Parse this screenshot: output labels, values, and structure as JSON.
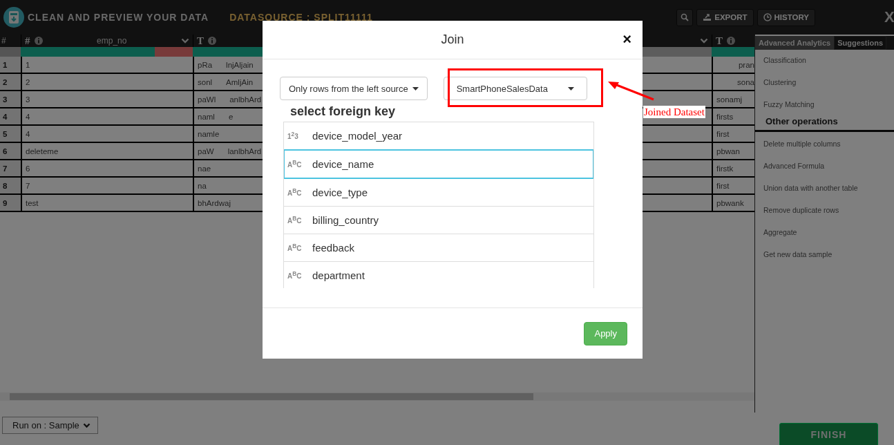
{
  "header": {
    "title": "CLEAN AND PREVIEW YOUR DATA",
    "datasource": "DATASOURCE : SPLIT11111",
    "buttons": [
      {
        "kind": "search"
      },
      {
        "kind": "export",
        "label": "EXPORT"
      },
      {
        "kind": "history",
        "label": "HISTORY"
      }
    ],
    "close": "X"
  },
  "table": {
    "index_heading": "#",
    "columns": [
      {
        "type": "#",
        "name": "emp_no",
        "level": 0.78,
        "menu": true
      },
      {
        "type": "T",
        "level": 0.5,
        "menu": true
      },
      {
        "type": "T",
        "menu": false
      }
    ],
    "rows": [
      {
        "index": "1",
        "cells": [
          [
            "1"
          ],
          [
            "pRa",
            "lnjAljain"
          ],
          [
            "pran"
          ]
        ],
        "right_aligned": true
      },
      {
        "index": "2",
        "cells": [
          [
            "2"
          ],
          [
            "sonl",
            "AmljAin"
          ],
          [
            "sona"
          ]
        ],
        "right_aligned": true
      },
      {
        "index": "3",
        "cells": [
          [
            "3"
          ],
          [
            "paWl",
            "anlbhArd"
          ],
          [
            "sonamj"
          ]
        ],
        "right_aligned": false
      },
      {
        "index": "4",
        "cells": [
          [
            "4"
          ],
          [
            "naml",
            "e"
          ],
          [
            "firsts"
          ]
        ],
        "right_aligned": false
      },
      {
        "index": "5",
        "cells": [
          [
            "4"
          ],
          [
            "namle"
          ],
          [
            "first"
          ]
        ],
        "right_aligned": false
      },
      {
        "index": "6",
        "cells": [
          [
            "deleteme"
          ],
          [
            "paW",
            "lanlbhArd"
          ],
          [
            "pbwan"
          ]
        ],
        "right_aligned": false
      },
      {
        "index": "7",
        "cells": [
          [
            "6"
          ],
          [
            "nae"
          ],
          [
            "firstk"
          ]
        ],
        "right_aligned": false
      },
      {
        "index": "8",
        "cells": [
          [
            "7"
          ],
          [
            "na"
          ],
          [
            "first"
          ]
        ],
        "right_aligned": false
      },
      {
        "index": "9",
        "cells": [
          [
            "test"
          ],
          [
            "bhArdwaj"
          ],
          [
            "pbwank"
          ]
        ],
        "right_aligned": false
      }
    ]
  },
  "side_panel": {
    "tabs": [
      {
        "label": "Advanced Analytics",
        "selected": true
      },
      {
        "label": "Suggestions",
        "selected": false
      }
    ],
    "sections": [
      {
        "items": [
          "Classification",
          "Clustering",
          "Fuzzy Matching"
        ]
      },
      {
        "heading": "Other operations",
        "items": [
          "Delete multiple columns",
          "Advanced Formula",
          "Union data with another table",
          "Remove duplicate rows",
          "Aggregate",
          "Get new data sample"
        ]
      }
    ]
  },
  "run_on": "Run on : Sample",
  "finish": "FINISH",
  "dialog": {
    "title": "Join",
    "close": "×",
    "join_type": "Only rows from the left source",
    "dataset": "SmartPhoneSalesData",
    "key_heading": "select foreign key",
    "keys": [
      {
        "type_label": "1$^{2}$3",
        "name": "device_model_year",
        "selected": false
      },
      {
        "type_label": "A$^{B}$C",
        "name": "device_name",
        "selected": true
      },
      {
        "type_label": "A$^{B}$C",
        "name": "device_type",
        "selected": false
      },
      {
        "type_label": "A$^{B}$C",
        "name": "billing_country",
        "selected": false
      },
      {
        "type_label": "A$^{B}$C",
        "name": "feedback",
        "selected": false
      },
      {
        "type_label": "A$^{B}$C",
        "name": "department",
        "selected": false
      }
    ],
    "apply": "Apply"
  },
  "annotation": {
    "label": "Joined Dataset"
  }
}
